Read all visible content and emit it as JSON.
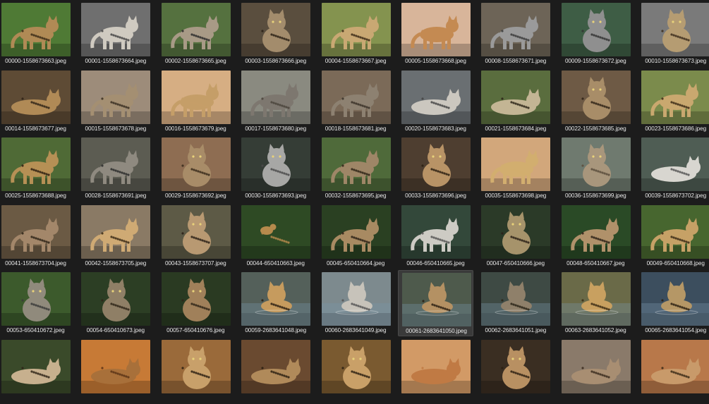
{
  "accent": "#3a3a3a",
  "thumbnails": [
    {
      "filename": "00000-1558673663.jpeg",
      "bg": "#4f7a35",
      "cat": "#b08a55",
      "spot": "#3a2a18",
      "pose": "stand"
    },
    {
      "filename": "00001-1558673664.jpeg",
      "bg": "#6f6f6f",
      "cat": "#cfcac0",
      "spot": "#444",
      "pose": "stand"
    },
    {
      "filename": "00002-1558673665.jpeg",
      "bg": "#55713f",
      "cat": "#a89a86",
      "spot": "#2a2a2a",
      "pose": "stand"
    },
    {
      "filename": "00003-1558673666.jpeg",
      "bg": "#5a4e3e",
      "cat": "#a38c6c",
      "spot": "#2a2015",
      "pose": "sit"
    },
    {
      "filename": "00004-1558673667.jpeg",
      "bg": "#84934f",
      "cat": "#c9a873",
      "spot": "#3b2a16",
      "pose": "stand"
    },
    {
      "filename": "00005-1558673668.jpeg",
      "bg": "#d8b59a",
      "cat": "#c48a52",
      "spot": "#c48a52",
      "pose": "stand"
    },
    {
      "filename": "00008-1558673671.jpeg",
      "bg": "#6d6457",
      "cat": "#9a9a9a",
      "spot": "#3a3a3a",
      "pose": "stand"
    },
    {
      "filename": "00009-1558673672.jpeg",
      "bg": "#3e5d45",
      "cat": "#8f8f8f",
      "spot": "#333",
      "pose": "sit"
    },
    {
      "filename": "00010-1558673673.jpeg",
      "bg": "#7a7a7a",
      "cat": "#b59c72",
      "spot": "#3c2d1c",
      "pose": "sit"
    },
    {
      "filename": "00014-1558673677.jpeg",
      "bg": "#5e4b35",
      "cat": "#b08a56",
      "spot": "#2e2216",
      "pose": "lie"
    },
    {
      "filename": "00015-1558673678.jpeg",
      "bg": "#9d8c7a",
      "cat": "#a48f72",
      "spot": "#3a2f22",
      "pose": "stand"
    },
    {
      "filename": "00016-1558673679.jpeg",
      "bg": "#d6ae83",
      "cat": "#c59e68",
      "spot": "#c59e68",
      "pose": "stand"
    },
    {
      "filename": "00017-1558673680.jpeg",
      "bg": "#8a8a80",
      "cat": "#7d776f",
      "spot": "#4a443c",
      "pose": "stand"
    },
    {
      "filename": "00018-1558673681.jpeg",
      "bg": "#7b6a58",
      "cat": "#8d8171",
      "spot": "#3a3128",
      "pose": "stand"
    },
    {
      "filename": "00020-1558673683.jpeg",
      "bg": "#6a6f72",
      "cat": "#cbc7bf",
      "spot": "#444",
      "pose": "lie"
    },
    {
      "filename": "00021-1558673684.jpeg",
      "bg": "#5a6d3e",
      "cat": "#c3b594",
      "spot": "#2c2418",
      "pose": "lie"
    },
    {
      "filename": "00022-1558673685.jpeg",
      "bg": "#6e5a45",
      "cat": "#a88d68",
      "spot": "#2e2216",
      "pose": "sit"
    },
    {
      "filename": "00023-1558673686.jpeg",
      "bg": "#7b8b4c",
      "cat": "#c9a86f",
      "spot": "#3b2a16",
      "pose": "stand"
    },
    {
      "filename": "00025-1558673688.jpeg",
      "bg": "#4f6a36",
      "cat": "#b69055",
      "spot": "#2b1f12",
      "pose": "stand"
    },
    {
      "filename": "00028-1558673691.jpeg",
      "bg": "#5c5c52",
      "cat": "#8f8a80",
      "spot": "#2c2c2c",
      "pose": "stand"
    },
    {
      "filename": "00029-1558673692.jpeg",
      "bg": "#8e6d52",
      "cat": "#a88c68",
      "spot": "#3a2c1c",
      "pose": "sit"
    },
    {
      "filename": "00030-1558673693.jpeg",
      "bg": "#353d36",
      "cat": "#a7a7a5",
      "spot": "#4a4a4a",
      "pose": "sit"
    },
    {
      "filename": "00032-1558673695.jpeg",
      "bg": "#4f6a3a",
      "cat": "#9e8667",
      "spot": "#2e2418",
      "pose": "stand"
    },
    {
      "filename": "00033-1558673696.jpeg",
      "bg": "#4e3e30",
      "cat": "#b89366",
      "spot": "#2a1e12",
      "pose": "sit"
    },
    {
      "filename": "00035-1558673698.jpeg",
      "bg": "#d2a77b",
      "cat": "#d2ae6f",
      "spot": "#d2ae6f",
      "pose": "stand"
    },
    {
      "filename": "00036-1558673699.jpeg",
      "bg": "#6f7a6f",
      "cat": "#a8967c",
      "spot": "#5a4d3d",
      "pose": "sit"
    },
    {
      "filename": "00039-1558673702.jpeg",
      "bg": "#4f5d54",
      "cat": "#d8d6d0",
      "spot": "#555",
      "pose": "lie"
    },
    {
      "filename": "00041-1558673704.jpeg",
      "bg": "#6b5a44",
      "cat": "#a3876a",
      "spot": "#2e2418",
      "pose": "stand"
    },
    {
      "filename": "00042-1558673705.jpeg",
      "bg": "#8a7a65",
      "cat": "#cfaa74",
      "spot": "#3a2a16",
      "pose": "stand"
    },
    {
      "filename": "00043-1558673707.jpeg",
      "bg": "#5d5a46",
      "cat": "#b89972",
      "spot": "#2a2016",
      "pose": "sit"
    },
    {
      "filename": "00044-650410663.jpeg",
      "bg": "#2e4a24",
      "cat": "#b68a4c",
      "spot": "#b68a4c",
      "pose": "small"
    },
    {
      "filename": "00045-650410664.jpeg",
      "bg": "#2a4022",
      "cat": "#a88a62",
      "spot": "#2a2016",
      "pose": "stand"
    },
    {
      "filename": "00046-650410665.jpeg",
      "bg": "#33483a",
      "cat": "#cdcbc4",
      "spot": "#555",
      "pose": "stand"
    },
    {
      "filename": "00047-650410666.jpeg",
      "bg": "#2b3a28",
      "cat": "#a6936b",
      "spot": "#2a2016",
      "pose": "sit"
    },
    {
      "filename": "00048-650410667.jpeg",
      "bg": "#2a4a26",
      "cat": "#b0916a",
      "spot": "#2a2016",
      "pose": "stand"
    },
    {
      "filename": "00049-650410668.jpeg",
      "bg": "#47662f",
      "cat": "#c6a166",
      "spot": "#3a2a16",
      "pose": "stand"
    },
    {
      "filename": "00053-650410672.jpeg",
      "bg": "#3c5a2c",
      "cat": "#908a7c",
      "spot": "#3a3a3a",
      "pose": "sit"
    },
    {
      "filename": "00054-650410673.jpeg",
      "bg": "#2c3e24",
      "cat": "#8f7f66",
      "spot": "#2e2418",
      "pose": "sit"
    },
    {
      "filename": "00057-650410676.jpeg",
      "bg": "#2a3a22",
      "cat": "#a0805a",
      "spot": "#2e2418",
      "pose": "sit"
    },
    {
      "filename": "00059-2683641048.jpeg",
      "bg": "#54605a",
      "cat": "#c69b5e",
      "spot": "#2a1e12",
      "pose": "water"
    },
    {
      "filename": "00060-2683641049.jpeg",
      "bg": "#7d8a8e",
      "cat": "#c7c3ba",
      "spot": "#555",
      "pose": "water"
    },
    {
      "filename": "00061-2683641050.jpeg",
      "bg": "#4e5a4c",
      "cat": "#b49163",
      "spot": "#2a1e12",
      "pose": "water"
    },
    {
      "filename": "00062-2683641051.jpeg",
      "bg": "#3e4a44",
      "cat": "#8f806a",
      "spot": "#2a2418",
      "pose": "water"
    },
    {
      "filename": "00063-2683641052.jpeg",
      "bg": "#6a6a48",
      "cat": "#c8a060",
      "spot": "#3a2a14",
      "pose": "water"
    },
    {
      "filename": "00065-2683641054.jpeg",
      "bg": "#3c4e5e",
      "cat": "#b59766",
      "spot": "#2a1e12",
      "pose": "water"
    },
    {
      "filename": "",
      "bg": "#3a4a2a",
      "cat": "#c7b08e",
      "spot": "#2e2418",
      "pose": "lie"
    },
    {
      "filename": "",
      "bg": "#c77a36",
      "cat": "#a8703a",
      "spot": "#5a3418",
      "pose": "lie"
    },
    {
      "filename": "",
      "bg": "#9a6a3a",
      "cat": "#c8a06a",
      "spot": "#2a1e12",
      "pose": "sit"
    },
    {
      "filename": "",
      "bg": "#6a4a30",
      "cat": "#b08a5a",
      "spot": "#2a1e12",
      "pose": "lie"
    },
    {
      "filename": "",
      "bg": "#7a5a30",
      "cat": "#c9a068",
      "spot": "#2a1e12",
      "pose": "sit"
    },
    {
      "filename": "",
      "bg": "#d29a66",
      "cat": "#c07a44",
      "spot": "#c07a44",
      "pose": "lie"
    },
    {
      "filename": "",
      "bg": "#3a2e22",
      "cat": "#b89062",
      "spot": "#2a1e12",
      "pose": "sit"
    },
    {
      "filename": "",
      "bg": "#8a7a6a",
      "cat": "#a88e72",
      "spot": "#3a2c1e",
      "pose": "lie"
    },
    {
      "filename": "",
      "bg": "#b8784a",
      "cat": "#c89a6a",
      "spot": "#3a2a16",
      "pose": "lie"
    }
  ],
  "selected_index": 41
}
